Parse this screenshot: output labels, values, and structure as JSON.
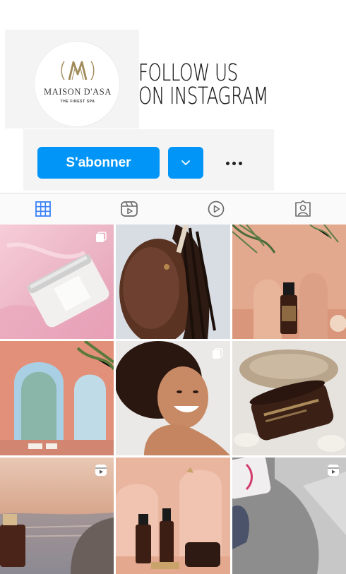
{
  "brand": {
    "name": "MAISON D'ASA",
    "tagline": "THE FINEST SPA"
  },
  "headline": {
    "line1": "FOLLOW US",
    "line2": "ON INSTAGRAM"
  },
  "actions": {
    "follow_label": "S'abonner",
    "dropdown_icon": "chevron-down-icon",
    "more_icon": "more-options-icon"
  },
  "tabs": [
    {
      "icon": "grid-icon",
      "active": true
    },
    {
      "icon": "reels-icon",
      "active": false
    },
    {
      "icon": "video-play-icon",
      "active": false
    },
    {
      "icon": "tagged-user-icon",
      "active": false
    }
  ],
  "posts": [
    {
      "subject": "face cream jar on pink silk",
      "badge": "multi-post-icon"
    },
    {
      "subject": "woman applying serum dropper",
      "badge": ""
    },
    {
      "subject": "serum bottle with palm leaves",
      "badge": ""
    },
    {
      "subject": "pink moorish arches and pool",
      "badge": ""
    },
    {
      "subject": "smiling woman portrait",
      "badge": "multi-post-icon"
    },
    {
      "subject": "dark cream jar with shells",
      "badge": ""
    },
    {
      "subject": "perfume bottle at sunset beach",
      "badge": "reel-icon"
    },
    {
      "subject": "product line on pink arches",
      "badge": ""
    },
    {
      "subject": "bottle held in hand",
      "badge": "reel-icon"
    }
  ],
  "colors": {
    "accent": "#0095f6",
    "logo_gold": "#a08a5a",
    "tab_active": "#3b82f6",
    "tab_inactive": "#6b6b6b"
  }
}
